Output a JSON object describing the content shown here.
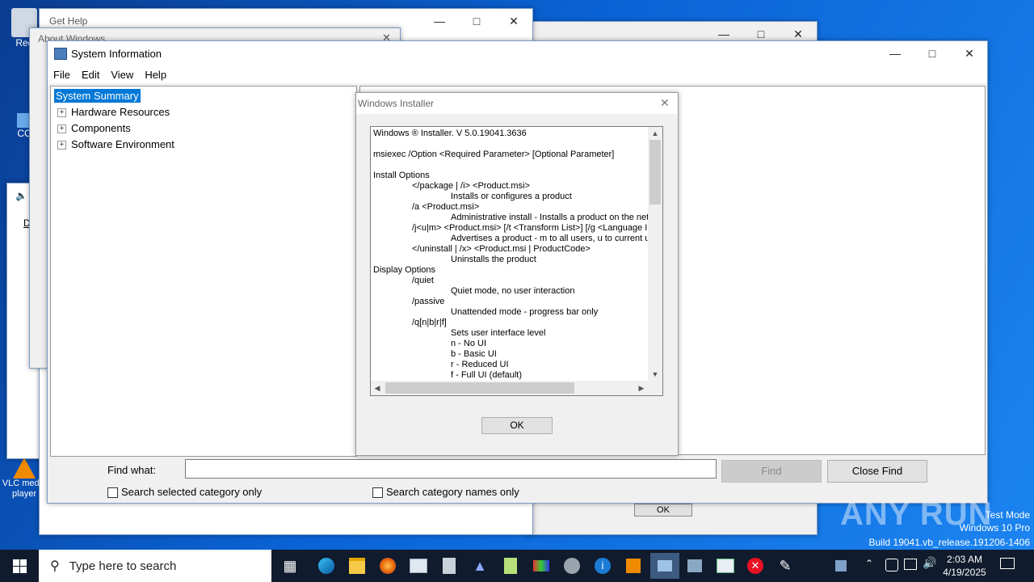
{
  "desktop": {
    "icons": [
      {
        "label": "Rec"
      },
      {
        "label": "CC"
      },
      {
        "label": "VLC media player"
      }
    ],
    "watermark": {
      "brand": "ANY RUN",
      "line1": "Test Mode",
      "line2": "Windows 10 Pro",
      "line3": "Build 19041.vb_release.191206-1406"
    }
  },
  "background_windows": {
    "get_help_title": "Get Help",
    "about_windows_title": "About Windows",
    "ok_label": "OK",
    "d_label": "D"
  },
  "sysinfo": {
    "title": "System Information",
    "menu": [
      "File",
      "Edit",
      "View",
      "Help"
    ],
    "tree": {
      "selected": "System Summary",
      "items": [
        "Hardware Resources",
        "Components",
        "Software Environment"
      ]
    },
    "find": {
      "label": "Find what:",
      "value": "",
      "find_button": "Find",
      "close_find_button": "Close Find",
      "search_selected_label": "Search selected category only",
      "search_names_label": "Search category names only"
    }
  },
  "installer_dialog": {
    "title": "Windows Installer",
    "ok_label": "OK",
    "lines": [
      "Windows ® Installer. V 5.0.19041.3636",
      "",
      "msiexec /Option <Required Parameter> [Optional Parameter]",
      "",
      "Install Options",
      "\t</package | /i> <Product.msi>",
      "\t\tInstalls or configures a product",
      "\t/a <Product.msi>",
      "\t\tAdministrative install - Installs a product on the netw",
      "\t/j<u|m> <Product.msi> [/t <Transform List>] [/g <Language ID",
      "\t\tAdvertises a product - m to all users, u to current use",
      "\t</uninstall | /x> <Product.msi | ProductCode>",
      "\t\tUninstalls the product",
      "Display Options",
      "\t/quiet",
      "\t\tQuiet mode, no user interaction",
      "\t/passive",
      "\t\tUnattended mode - progress bar only",
      "\t/q[n|b|r|f]",
      "\t\tSets user interface level",
      "\t\tn - No UI",
      "\t\tb - Basic UI",
      "\t\tr - Reduced UI",
      "\t\tf - Full UI (default)"
    ]
  },
  "taskbar": {
    "search_placeholder": "Type here to search",
    "time": "2:03 AM",
    "date": "4/19/2025",
    "apps": [
      "task-view",
      "edge",
      "file-explorer",
      "firefox",
      "app-window",
      "clipboard",
      "acrobat",
      "notepad-plus",
      "paint",
      "media",
      "info",
      "vlc",
      "system-info",
      "control-panel",
      "window",
      "error",
      "help-chat"
    ]
  },
  "colors": {
    "selection": "#0078d7",
    "taskbar": "#101b2d",
    "accent": "#0a5fc8"
  }
}
